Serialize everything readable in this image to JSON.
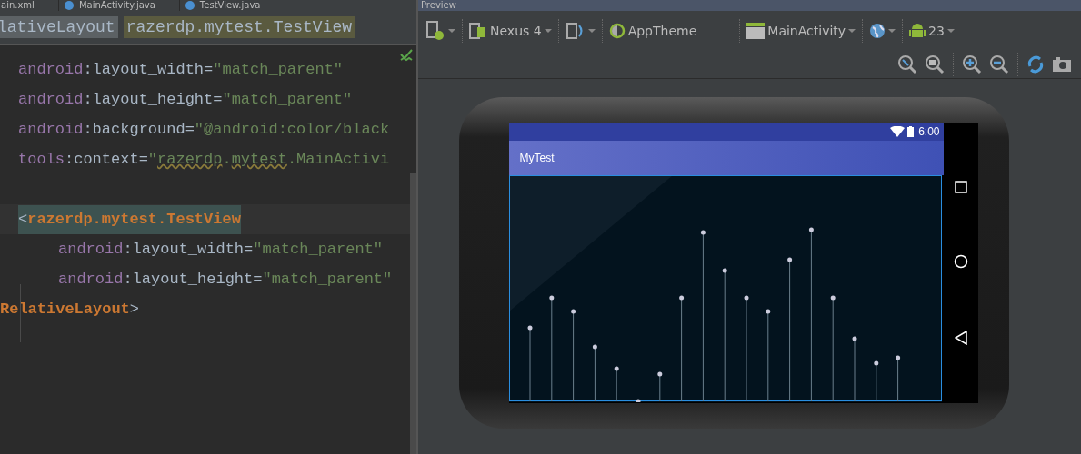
{
  "editor_tabs": [
    {
      "label": "ain.xml",
      "selected": false
    },
    {
      "label": "MainActivity.java",
      "selected": false
    },
    {
      "label": "TestView.java",
      "selected": false
    }
  ],
  "breadcrumbs": [
    {
      "label": "lativeLayout",
      "selected": false
    },
    {
      "label": "razerdp.mytest.TestView",
      "selected": true
    }
  ],
  "code_lines": [
    {
      "kind": "attr",
      "highlighted": false,
      "tokens": [
        {
          "kind": "ns",
          "t": "android"
        },
        {
          "kind": "plain",
          "t": ":layout_width="
        },
        {
          "kind": "str",
          "t": "\"match_parent\""
        }
      ]
    },
    {
      "kind": "attr",
      "highlighted": false,
      "tokens": [
        {
          "kind": "ns",
          "t": "android"
        },
        {
          "kind": "plain",
          "t": ":layout_height="
        },
        {
          "kind": "str",
          "t": "\"match_parent\""
        }
      ]
    },
    {
      "kind": "attr",
      "highlighted": false,
      "tokens": [
        {
          "kind": "ns",
          "t": "android"
        },
        {
          "kind": "plain",
          "t": ":background="
        },
        {
          "kind": "str",
          "t": "\"@android:color/black"
        }
      ]
    },
    {
      "kind": "attr",
      "highlighted": false,
      "tokens": [
        {
          "kind": "ns",
          "t": "tools"
        },
        {
          "kind": "plain",
          "t": ":context="
        },
        {
          "kind": "str",
          "t": "\""
        },
        {
          "kind": "warn",
          "t": "razerdp"
        },
        {
          "kind": "str",
          "t": "."
        },
        {
          "kind": "warn",
          "t": "mytest"
        },
        {
          "kind": "str",
          "t": ".MainActivi"
        }
      ]
    },
    {
      "kind": "blank"
    },
    {
      "kind": "element",
      "highlighted": true,
      "tokens": [
        {
          "kind": "plain",
          "t": "<"
        },
        {
          "kind": "tag",
          "t": "razerdp.mytest.TestView"
        }
      ],
      "children": [
        {
          "kind": "attr",
          "highlighted": false,
          "tokens": [
            {
              "kind": "ns",
              "t": "android"
            },
            {
              "kind": "plain",
              "t": ":layout_width="
            },
            {
              "kind": "str",
              "t": "\"match_parent\""
            }
          ]
        },
        {
          "kind": "attr",
          "highlighted": false,
          "tokens": [
            {
              "kind": "ns",
              "t": "android"
            },
            {
              "kind": "plain",
              "t": ":layout_height="
            },
            {
              "kind": "str",
              "t": "\"match_parent\""
            }
          ]
        }
      ]
    },
    {
      "kind": "closing",
      "highlighted": false,
      "tokens": [
        {
          "kind": "tag",
          "t": "RelativeLayout"
        },
        {
          "kind": "plain",
          "t": ">"
        }
      ]
    }
  ],
  "preview": {
    "title": "Preview",
    "toolbar": [
      {
        "kind": "device-type"
      },
      {
        "kind": "device",
        "label": "Nexus 4"
      },
      {
        "kind": "orientation"
      },
      {
        "kind": "theme",
        "label": "AppTheme"
      },
      {
        "kind": "activity",
        "label": "MainActivity"
      },
      {
        "kind": "locale"
      },
      {
        "kind": "api",
        "label": "23"
      }
    ],
    "phone": {
      "status_time": "6:00",
      "app_title": "MyTest"
    }
  }
}
